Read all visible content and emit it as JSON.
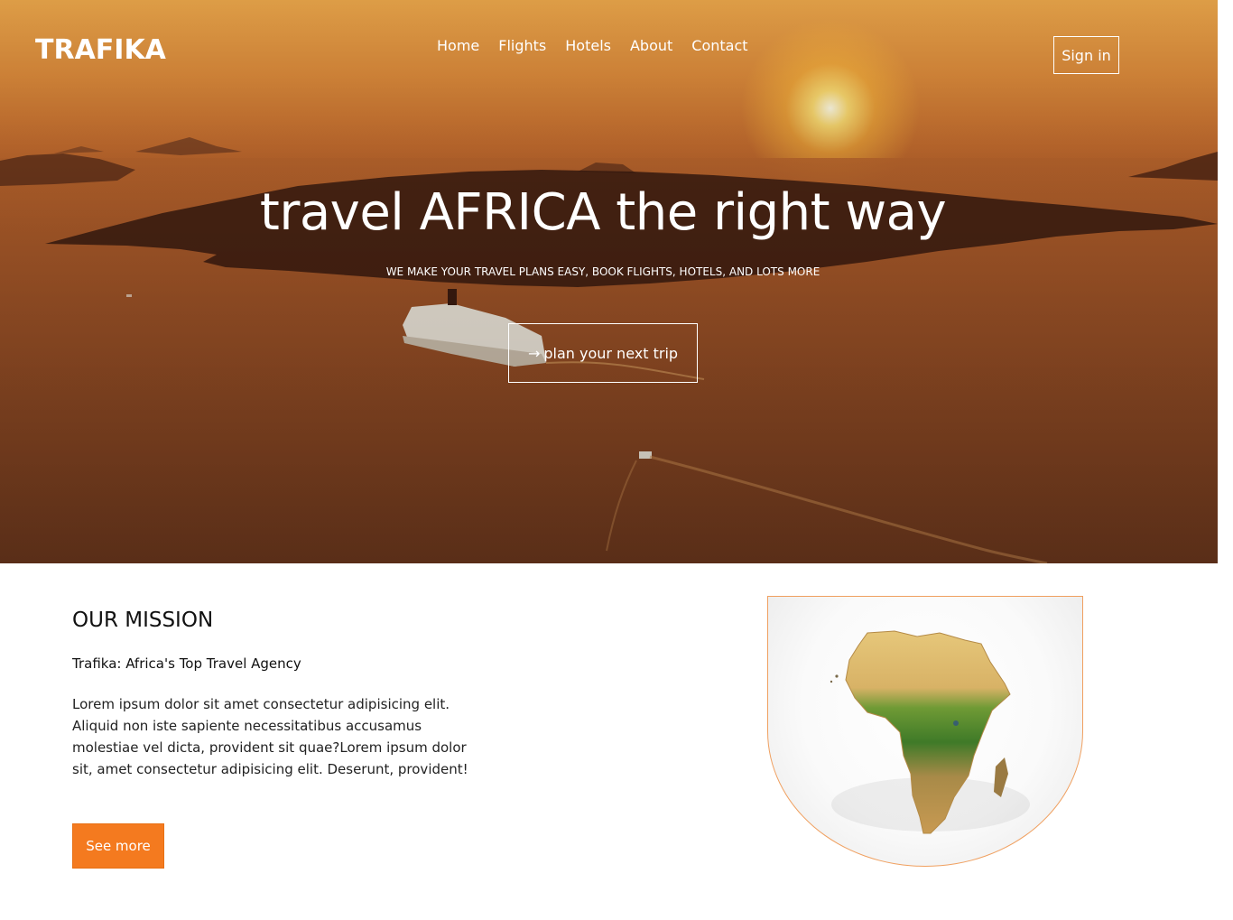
{
  "brand": {
    "logo": "TRAFIKA"
  },
  "nav": {
    "items": [
      {
        "label": "Home"
      },
      {
        "label": "Flights"
      },
      {
        "label": "Hotels"
      },
      {
        "label": "About"
      },
      {
        "label": "Contact"
      }
    ],
    "signin_label": "Sign in"
  },
  "hero": {
    "title": "travel AFRICA the right way",
    "subtitle": "WE MAKE YOUR TRAVEL PLANS EASY, BOOK FLIGHTS, HOTELS, AND LOTS MORE",
    "cta_icon": "arrow-right-icon",
    "cta_arrow": "→",
    "cta_label": "plan your next trip",
    "image": "sunset-sea-cruise-ship"
  },
  "mission": {
    "heading": "OUR MISSION",
    "subheading": "Trafika: Africa's Top Travel Agency",
    "body": "Lorem ipsum dolor sit amet consectetur adipisicing elit. Aliquid non iste sapiente necessitatibus accusamus molestiae vel dicta, provident sit quae?Lorem ipsum dolor sit, amet consectetur adipisicing elit. Deserunt, provident!",
    "button_label": "See more",
    "image": "africa-map"
  },
  "colors": {
    "accent": "#f47a1f",
    "accent_border": "#f0a060",
    "hero_text": "#ffffff"
  }
}
